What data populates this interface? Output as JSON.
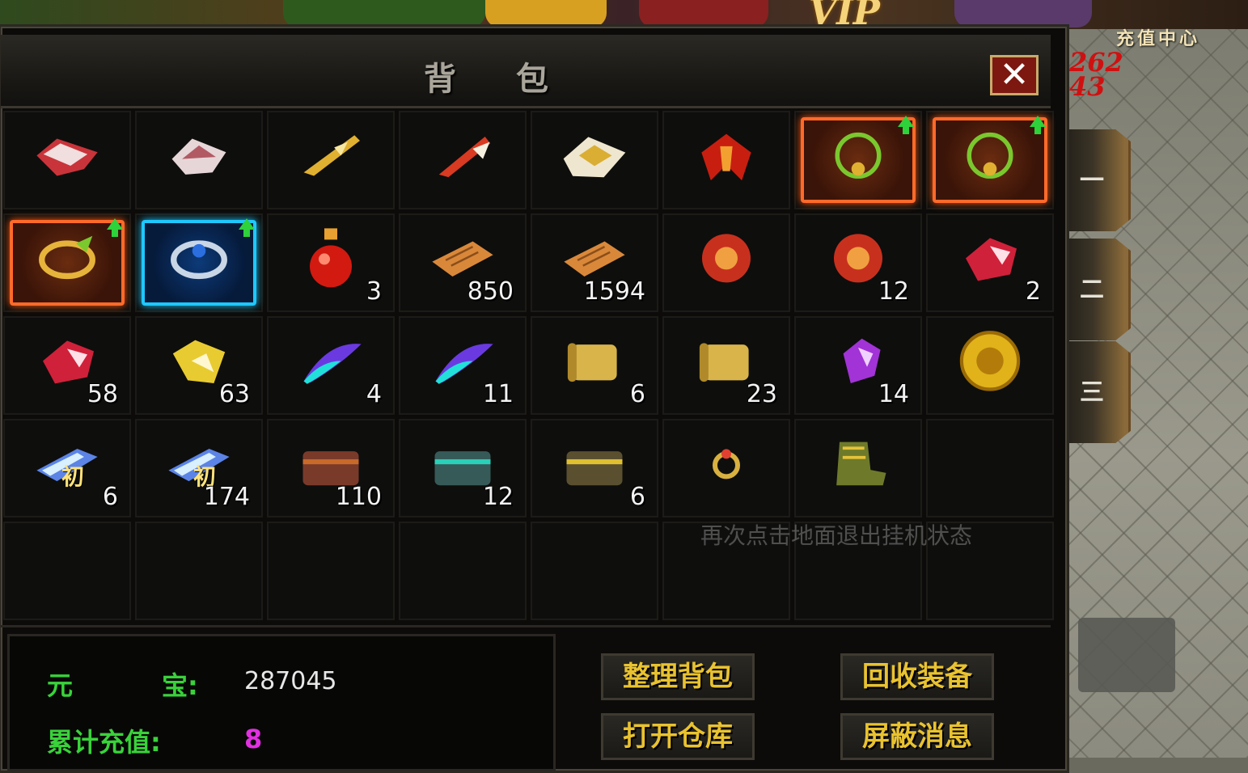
{
  "top_hud": {
    "vip_text": "VIP",
    "recharge_label": "充值中心",
    "damage_text": "262\n43"
  },
  "side_tabs": [
    "一",
    "二",
    "三"
  ],
  "bag": {
    "title": "背 包",
    "close_glyph": "✕",
    "hint_text": "再次点击地面退出挂机状态",
    "cells": [
      {
        "item": "red-white-armor-icon",
        "count": "",
        "frame": "",
        "upgrade": false
      },
      {
        "item": "white-armor-icon",
        "count": "",
        "frame": "",
        "upgrade": false
      },
      {
        "item": "golden-blade-icon",
        "count": "",
        "frame": "",
        "upgrade": false
      },
      {
        "item": "red-blade-icon",
        "count": "",
        "frame": "",
        "upgrade": false
      },
      {
        "item": "white-gold-armor-icon",
        "count": "",
        "frame": "",
        "upgrade": false
      },
      {
        "item": "red-demon-wings-icon",
        "count": "",
        "frame": "",
        "upgrade": false
      },
      {
        "item": "green-vine-necklace-icon",
        "count": "",
        "frame": "orange",
        "upgrade": true
      },
      {
        "item": "green-vine-necklace-icon",
        "count": "",
        "frame": "orange",
        "upgrade": true
      },
      {
        "item": "golden-dragon-bracelet-icon",
        "count": "",
        "frame": "orange",
        "upgrade": true
      },
      {
        "item": "blue-silver-bracelet-icon",
        "count": "",
        "frame": "blue",
        "upgrade": true
      },
      {
        "item": "red-potion-icon",
        "count": "3",
        "frame": "",
        "upgrade": false
      },
      {
        "item": "scroll-parchment-icon",
        "count": "850",
        "frame": "",
        "upgrade": false
      },
      {
        "item": "scroll-parchment-icon",
        "count": "1594",
        "frame": "",
        "upgrade": false
      },
      {
        "item": "red-orb-icon",
        "count": "",
        "frame": "",
        "upgrade": false
      },
      {
        "item": "red-orb-icon",
        "count": "12",
        "frame": "",
        "upgrade": false
      },
      {
        "item": "red-gem-icon",
        "count": "2",
        "frame": "",
        "upgrade": false
      },
      {
        "item": "red-gem-icon",
        "count": "58",
        "frame": "",
        "upgrade": false
      },
      {
        "item": "gold-crystal-icon",
        "count": "63",
        "frame": "",
        "upgrade": false
      },
      {
        "item": "blue-feather-icon",
        "count": "4",
        "frame": "",
        "upgrade": false
      },
      {
        "item": "blue-feather-icon",
        "count": "11",
        "frame": "",
        "upgrade": false
      },
      {
        "item": "gold-scroll-icon",
        "count": "6",
        "frame": "",
        "upgrade": false
      },
      {
        "item": "gold-scroll-icon",
        "count": "23",
        "frame": "",
        "upgrade": false
      },
      {
        "item": "purple-crystal-icon",
        "count": "14",
        "frame": "",
        "upgrade": false
      },
      {
        "item": "gold-coin-icon",
        "count": "",
        "frame": "",
        "upgrade": false
      },
      {
        "item": "blue-stone-icon",
        "count": "6",
        "frame": "",
        "upgrade": false,
        "mark": "初"
      },
      {
        "item": "blue-stone-icon",
        "count": "174",
        "frame": "",
        "upgrade": false,
        "mark": "初"
      },
      {
        "item": "red-chest-icon",
        "count": "110",
        "frame": "",
        "upgrade": false
      },
      {
        "item": "teal-chest-icon",
        "count": "12",
        "frame": "",
        "upgrade": false
      },
      {
        "item": "gold-chest-icon",
        "count": "6",
        "frame": "",
        "upgrade": false
      },
      {
        "item": "ring-icon",
        "count": "",
        "frame": "",
        "upgrade": false
      },
      {
        "item": "green-boots-icon",
        "count": "",
        "frame": "",
        "upgrade": false
      },
      {
        "item": "",
        "count": "",
        "frame": "",
        "upgrade": false
      },
      {
        "item": "",
        "count": "",
        "frame": "",
        "upgrade": false
      },
      {
        "item": "",
        "count": "",
        "frame": "",
        "upgrade": false
      },
      {
        "item": "",
        "count": "",
        "frame": "",
        "upgrade": false
      },
      {
        "item": "",
        "count": "",
        "frame": "",
        "upgrade": false
      },
      {
        "item": "",
        "count": "",
        "frame": "",
        "upgrade": false
      },
      {
        "item": "",
        "count": "",
        "frame": "",
        "upgrade": false
      },
      {
        "item": "",
        "count": "",
        "frame": "",
        "upgrade": false
      },
      {
        "item": "",
        "count": "",
        "frame": "",
        "upgrade": false
      }
    ]
  },
  "currency": {
    "yuanbao_label_1": "元",
    "yuanbao_label_2": "宝:",
    "yuanbao_value": "287045",
    "recharge_total_label": "累计充值:",
    "recharge_total_value": "8"
  },
  "buttons": {
    "sort_bag": "整理背包",
    "recycle_equipment": "回收装备",
    "open_warehouse": "打开仓库",
    "block_messages": "屏蔽消息"
  }
}
